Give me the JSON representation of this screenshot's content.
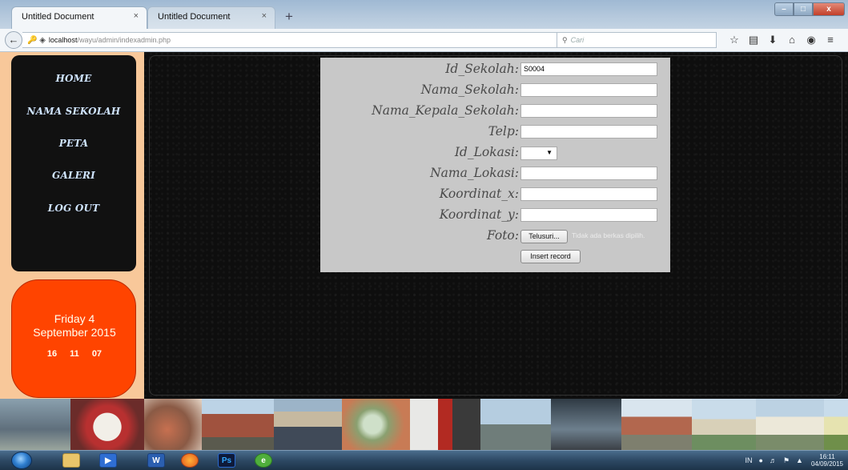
{
  "browser": {
    "tabs": [
      {
        "title": "Untitled Document",
        "active": true
      },
      {
        "title": "Untitled Document",
        "active": false
      }
    ],
    "new_tab_glyph": "+",
    "close_glyph": "×",
    "url_host": "localhost",
    "url_path": "/wayu/admin/indexadmin.php",
    "search_placeholder": "Cari",
    "toolbar_icons": [
      "star-icon",
      "bookmarks-icon",
      "download-icon",
      "home-icon",
      "chat-icon",
      "menu-icon"
    ]
  },
  "sidebar": {
    "menu": [
      "HOME",
      "NAMA SEKOLAH",
      "PETA",
      "GALERI",
      "LOG OUT"
    ]
  },
  "clock": {
    "day": "Friday 4",
    "date": "September 2015",
    "hours": "16",
    "minutes": "11",
    "seconds": "07"
  },
  "form": {
    "fields": [
      {
        "label": "Id_Sekolah:",
        "value": "S0004"
      },
      {
        "label": "Nama_Sekolah:",
        "value": ""
      },
      {
        "label": "Nama_Kepala_Sekolah:",
        "value": ""
      },
      {
        "label": "Telp:",
        "value": ""
      },
      {
        "label": "Id_Lokasi:",
        "value": ""
      },
      {
        "label": "Nama_Lokasi:",
        "value": ""
      },
      {
        "label": "Koordinat_x:",
        "value": ""
      },
      {
        "label": "Koordinat_y:",
        "value": ""
      },
      {
        "label": "Foto:",
        "value": ""
      }
    ],
    "browse_label": "Telusuri...",
    "no_file_text": "Tidak ada berkas dipilih.",
    "submit_label": "Insert record"
  },
  "taskbar": {
    "apps": [
      "explorer",
      "media-player",
      "word",
      "firefox",
      "photoshop",
      "edge"
    ],
    "ps_label": "Ps",
    "lang": "IN",
    "time": "16:11",
    "date": "04/09/2015"
  },
  "colors": {
    "page_bg": "#f8c89a",
    "content_bg": "#0e0e0e",
    "menu_bg": "#111111",
    "menu_text": "#cfe4ff",
    "clock_bg": "#ff4400",
    "form_bg": "#c8c8c8"
  }
}
